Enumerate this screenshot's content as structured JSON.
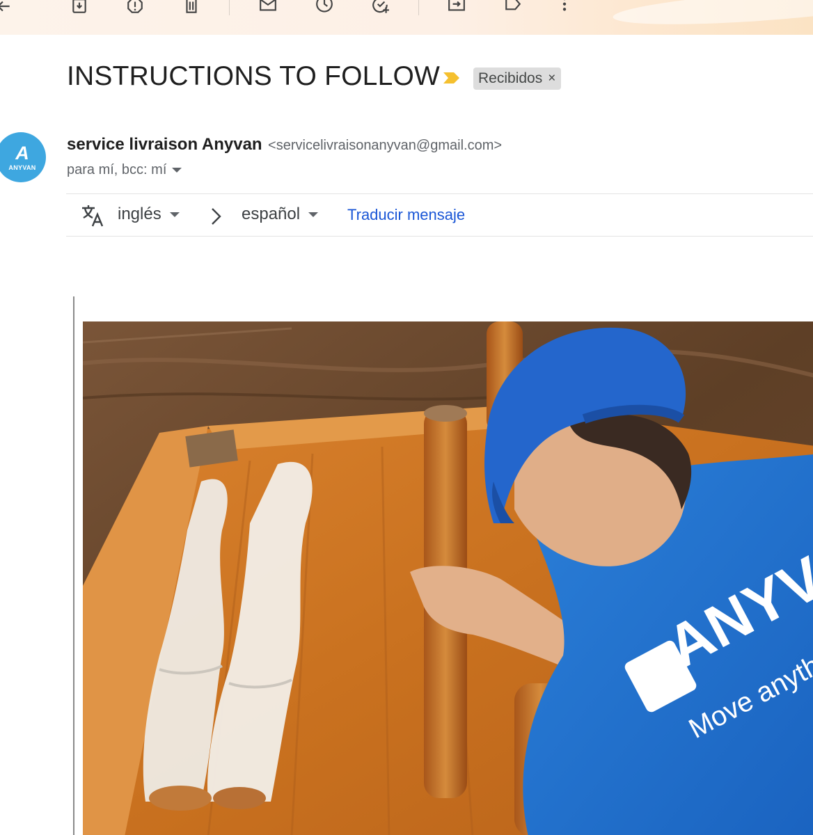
{
  "toolbar": {
    "icons": [
      "back-arrow-icon",
      "archive-icon",
      "report-spam-icon",
      "delete-icon",
      "mark-unread-icon",
      "snooze-icon",
      "add-task-icon",
      "move-to-icon",
      "label-icon",
      "more-options-icon"
    ]
  },
  "email": {
    "subject": "INSTRUCTIONS TO FOLLOW",
    "label": "Recibidos",
    "label_close": "×",
    "sender_name": "service livraison Anyvan",
    "sender_email": "<servicelivraisonanyvan@gmail.com>",
    "recipients": "para mí, bcc: mí",
    "avatar": {
      "mark": "A",
      "text": "ANYVAN",
      "color": "#3ea7e0"
    }
  },
  "translate": {
    "source_lang": "inglés",
    "target_lang": "español",
    "action": "Traducir mensaje"
  },
  "image": {
    "shirt_logo": "ANYV",
    "shirt_tagline": "Move anythin"
  },
  "colors": {
    "link": "#1a56d6",
    "importance": "#f5c02f",
    "toolbar_bg": "#fdf0e6"
  }
}
